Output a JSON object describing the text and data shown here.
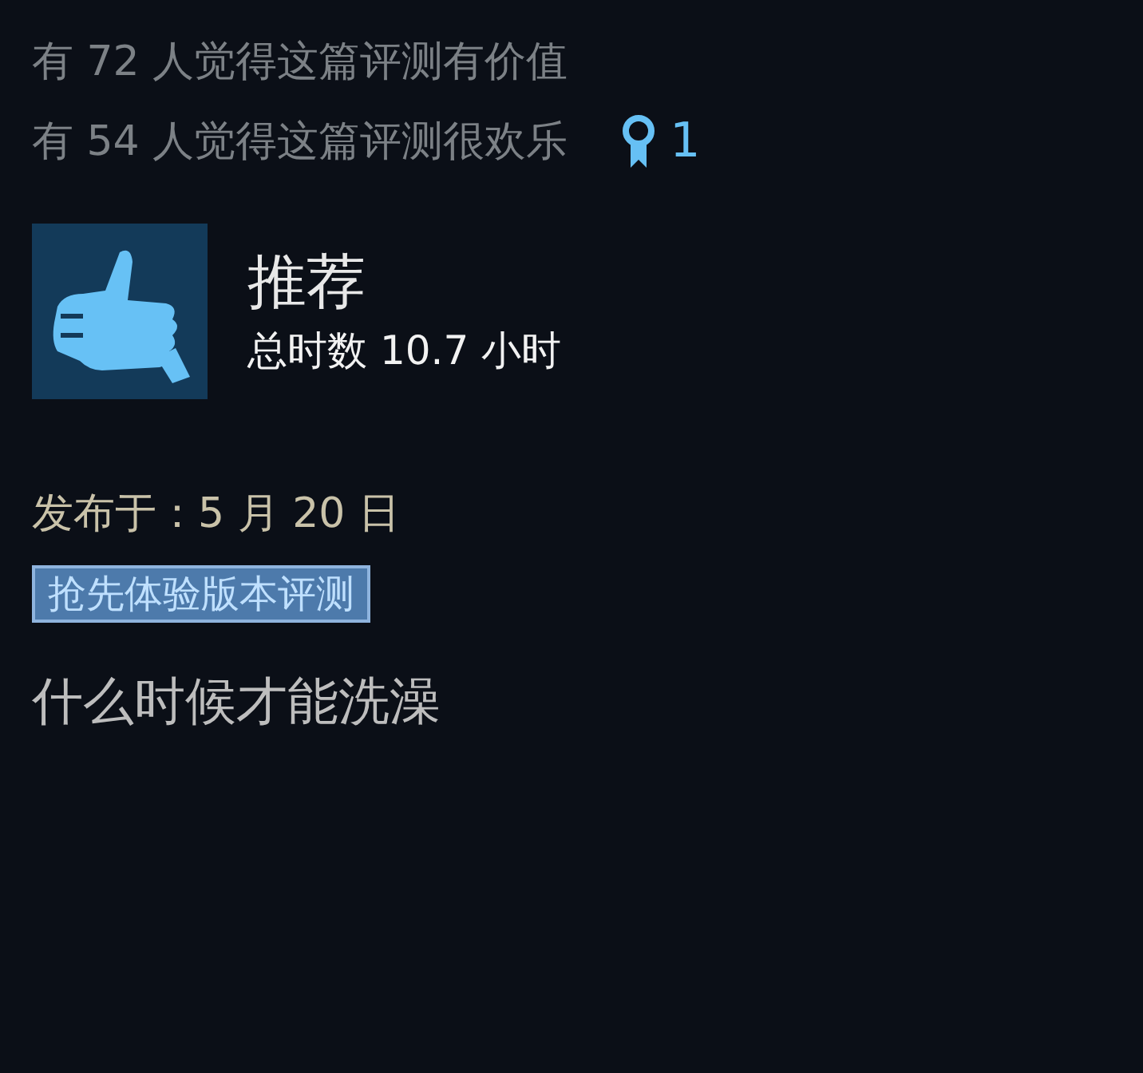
{
  "votes": [
    {
      "text": "有 72 人觉得这篇评测有价值"
    },
    {
      "text": "有 54 人觉得这篇评测很欢乐"
    }
  ],
  "award": {
    "count": "1"
  },
  "verdict": {
    "title": "推荐",
    "hours": "总时数 10.7 小时"
  },
  "posted": "发布于：5 月 20 日",
  "tag": "抢先体验版本评测",
  "body": "什么时候才能洗澡"
}
